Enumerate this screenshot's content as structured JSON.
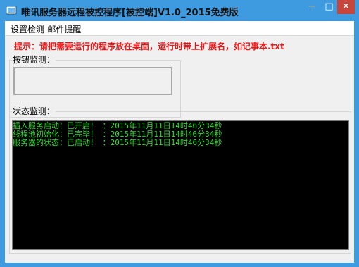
{
  "window": {
    "title": "唯讯服务器远程被控程序[被控端]V1.0_2015免费版",
    "controls": {
      "minimize": "─",
      "maximize": "□",
      "close": "✕"
    }
  },
  "menu": {
    "items": [
      {
        "label": "设置检测-邮件提醒"
      }
    ]
  },
  "tip_text": "提示：请把需要运行的程序放在桌面，运行时带上扩展名，如记事本.txt",
  "button_monitor": {
    "label": "按钮监测："
  },
  "status_monitor": {
    "label": "状态监测：",
    "log": [
      "插入服务启动：已开启！ ：2015年11月11日14时46分34秒",
      "线程池初始化：已完毕！ ：2015年11月11日14时46分34秒",
      "服务器的状态：已启动！ ：2015年11月11日14时46分34秒"
    ]
  },
  "colors": {
    "titlebar": "#3f9be0",
    "tip": "#e81818",
    "log_text": "#2ede2e",
    "console_bg": "#000000",
    "close_button": "#c7453b"
  }
}
